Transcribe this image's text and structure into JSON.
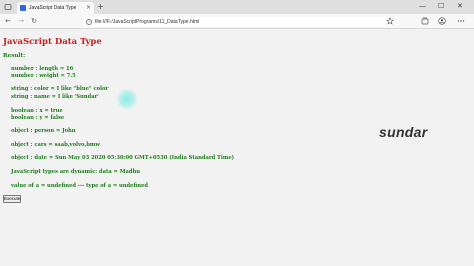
{
  "browser": {
    "tab_title": "JavaScript Data Type",
    "tab_close": "×",
    "new_tab": "+",
    "url": "file:///F:/JavaScriptPrograms/11_DataType.html",
    "minimize": "—",
    "maximize": "☐",
    "close": "✕",
    "back": "←",
    "forward": "→",
    "reload": "↻",
    "info": "i"
  },
  "page": {
    "heading": "JavaScript Data Type",
    "result_label": "Result:",
    "lines": [
      "number : length = 16",
      "number : weight = 7.5",
      "string : color = I like \"blue\" color",
      "string : name = I like 'Sundar'",
      "boolean : x = true",
      "boolean : y = false",
      "object : person = John",
      "object : cars = saab,volvo,bmw",
      "object : date = Sun May 03 2020 05:30:00 GMT+0530 (India Standard Time)",
      "JavaScript types are dynamic: data = Madhu",
      "value of a = undefined --- type of a = undefined"
    ],
    "execute_label": "Execute",
    "overlay_text": "sundar"
  },
  "icons": {
    "favicon": "page-favicon-icon",
    "tab_actions": "tab-actions-icon",
    "favorite": "star-icon",
    "collections": "collections-icon",
    "profile": "profile-icon",
    "menu": "more-menu-icon"
  }
}
